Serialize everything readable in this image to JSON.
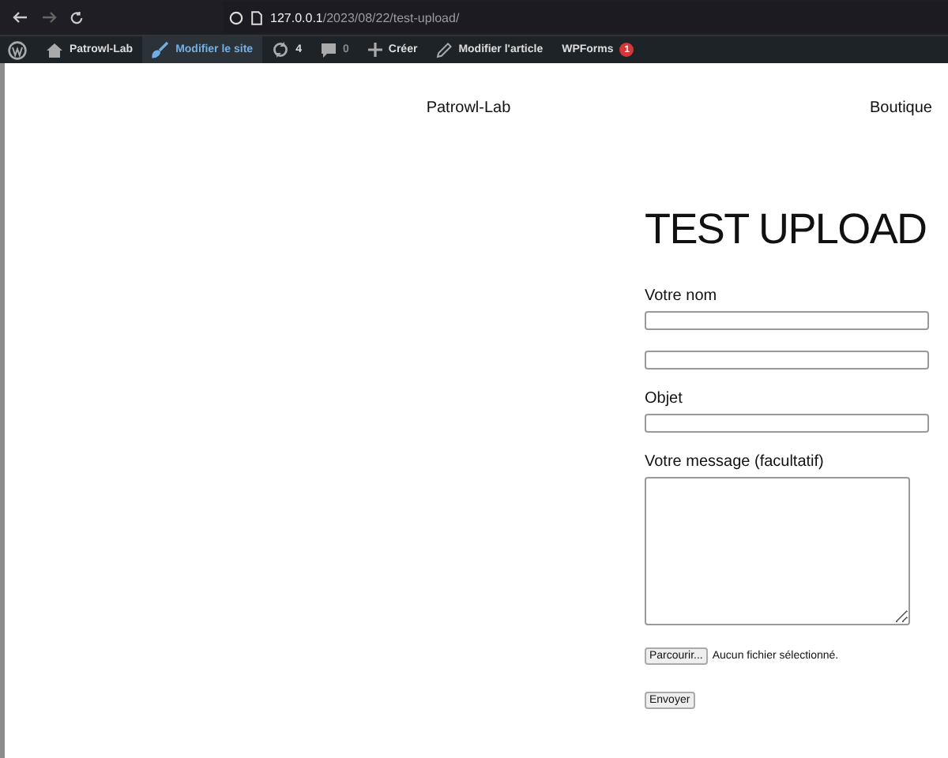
{
  "browser": {
    "url_host": "127.0.0.1",
    "url_path": "/2023/08/22/test-upload/"
  },
  "admin_bar": [
    {
      "kind": "logo",
      "selected": false
    },
    {
      "kind": "site",
      "label": "Patrowl-Lab",
      "selected": false
    },
    {
      "kind": "customize",
      "label": "Modifier le site",
      "selected": true
    },
    {
      "kind": "updates",
      "label": "4",
      "selected": false
    },
    {
      "kind": "comments",
      "label": "0",
      "selected": false
    },
    {
      "kind": "new",
      "label": "Créer",
      "selected": false
    },
    {
      "kind": "edit",
      "label": "Modifier l'article",
      "selected": false
    },
    {
      "kind": "plugin",
      "label": "WPForms",
      "badge": "1",
      "selected": false
    }
  ],
  "header": {
    "site_title": "Patrowl-Lab",
    "nav": [
      "Boutique"
    ]
  },
  "page_title": "TEST UPLOAD",
  "form": [
    {
      "kind": "label",
      "text": "Votre nom"
    },
    {
      "kind": "input"
    },
    {
      "kind": "input"
    },
    {
      "kind": "label",
      "text": "Objet"
    },
    {
      "kind": "input"
    },
    {
      "kind": "label",
      "text": "Votre message (facultatif)"
    },
    {
      "kind": "textarea"
    },
    {
      "kind": "file",
      "button": "Parcourir...",
      "status": "Aucun fichier sélectionné."
    },
    {
      "kind": "submit",
      "button": "Envoyer"
    }
  ]
}
